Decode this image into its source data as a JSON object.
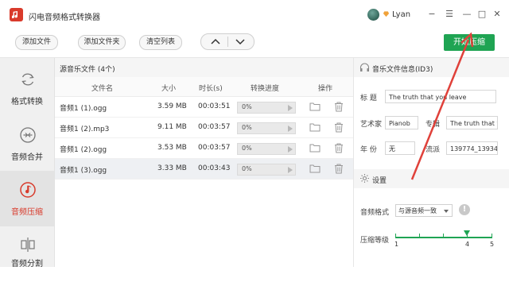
{
  "window": {
    "title": "闪电音频格式转换器",
    "user_name": "Lyan",
    "buttons": [
      "−",
      "☰",
      "—",
      "□",
      "✕"
    ]
  },
  "toolbar": {
    "add_file": "添加文件",
    "add_folder": "添加文件夹",
    "clear_list": "清空列表",
    "start_label": "开始压缩"
  },
  "sidebar": {
    "items": [
      {
        "label": "格式转换",
        "icon": "refresh-icon"
      },
      {
        "label": "音频合并",
        "icon": "merge-icon"
      },
      {
        "label": "音频压缩",
        "icon": "compress-icon"
      },
      {
        "label": "音频分割",
        "icon": "split-icon"
      }
    ]
  },
  "files": {
    "title": "源音乐文件 (4个)",
    "columns": [
      "文件名",
      "大小",
      "时长(s)",
      "转换进度",
      "操作"
    ],
    "rows": [
      {
        "name": "音频1 (1).ogg",
        "size": "3.59 MB",
        "duration": "00:03:51",
        "progress": "0%"
      },
      {
        "name": "音频1 (2).mp3",
        "size": "9.11 MB",
        "duration": "00:03:57",
        "progress": "0%"
      },
      {
        "name": "音频1 (2).ogg",
        "size": "3.53 MB",
        "duration": "00:03:57",
        "progress": "0%"
      },
      {
        "name": "音频1 (3).ogg",
        "size": "3.33 MB",
        "duration": "00:03:43",
        "progress": "0%"
      }
    ]
  },
  "id3": {
    "title": "音乐文件信息(ID3)",
    "labels": {
      "title": "标 题",
      "artist": "艺术家",
      "album": "专辑",
      "year": "年 份",
      "genre": "流派"
    },
    "values": {
      "title": "The truth that you leave",
      "artist": "Pianob",
      "album": "The truth that y",
      "year": "无",
      "genre": "139774_13934"
    }
  },
  "settings": {
    "title": "设置",
    "format_label": "音频格式",
    "format_value": "与源音频一致",
    "level_label": "压缩等级",
    "level_min": "1",
    "level_value": "4",
    "level_max": "5"
  },
  "colors": {
    "accent": "#1fa453",
    "brand": "#d93a2b",
    "annotation": "#e0413a"
  }
}
